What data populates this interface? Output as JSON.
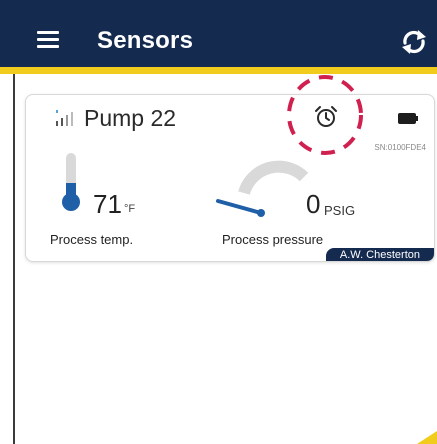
{
  "appbar": {
    "title": "Sensors",
    "menu_icon": "hamburger-menu-icon",
    "refresh_icon": "refresh-icon"
  },
  "sensor_card": {
    "name": "Pump 22",
    "serial": "SN:0100FDE4",
    "signal_icon": "signal-strength-icon",
    "alarm_icon": "alarm-clock-icon",
    "battery_icon": "battery-icon",
    "temperature": {
      "value": "71",
      "unit": "°F",
      "label": "Process temp."
    },
    "pressure": {
      "value": "0",
      "unit": "PSIG",
      "label": "Process pressure"
    },
    "brand": "A.W. Chesterton"
  },
  "colors": {
    "appbar": "#142a4f",
    "accent": "#f2cc1d",
    "sensor_blue": "#1f5fa8",
    "highlight": "#d0204f"
  }
}
